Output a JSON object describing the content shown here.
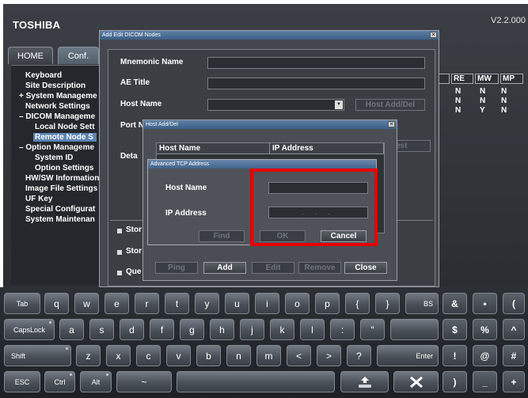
{
  "app": {
    "brand": "TOSHIBA",
    "version": "V2.2.000"
  },
  "tabs": [
    {
      "label": "HOME"
    },
    {
      "label": "Conf."
    }
  ],
  "tree": [
    "Keyboard",
    "Site Description",
    "System Manageme",
    "Network Settings",
    "DICOM Manageme",
    "Local Node Sett",
    "Remote Node S",
    "Option Manageme",
    "System ID",
    "Option Settings",
    "HW/SW Information",
    "Image File Settings",
    "UF Key",
    "Special Configurat",
    "System Maintenan"
  ],
  "right_table": {
    "headers": [
      "U",
      "RE",
      "MW",
      "MP"
    ],
    "rows": [
      [
        "N",
        "N",
        "N"
      ],
      [
        "N",
        "N",
        "N"
      ],
      [
        "N",
        "Y",
        "N"
      ]
    ]
  },
  "dicom_dialog": {
    "title": "Add Edit DICOM Nodes",
    "mnemonic_label": "Mnemonic Name",
    "ae_title_label": "AE Title",
    "host_name_label": "Host Name",
    "port_label": "Port N",
    "detail_label": "Deta",
    "host_add_del_button": "Host Add/Del",
    "test_button": "est",
    "dropdown_arrow": "▼",
    "checks": [
      "Stor",
      "Stor",
      "Que"
    ]
  },
  "host_dialog": {
    "title": "Host Add/Del",
    "col_host": "Host Name",
    "col_ip": "IP Address",
    "buttons": {
      "ping": "Ping",
      "add": "Add",
      "edit": "Edit",
      "remove": "Remove",
      "close": "Close"
    }
  },
  "tcp_dialog": {
    "title": "Advanced TCP Address",
    "host_label": "Host Name",
    "ip_label": "IP Address",
    "ip_dots": "  .   .   .  ",
    "find_button": "Find",
    "ok_button": "OK",
    "cancel_button": "Cancel"
  },
  "close_glyph": "✕",
  "keyboard": {
    "row1": [
      "Tab",
      "q",
      "w",
      "e",
      "r",
      "t",
      "y",
      "u",
      "i",
      "o",
      "p",
      "{",
      "}",
      "BS",
      "&",
      "•",
      "("
    ],
    "row2": [
      "CapsLock",
      "a",
      "s",
      "d",
      "f",
      "g",
      "h",
      "j",
      "k",
      "l",
      ":",
      "\"",
      "",
      "$",
      "%",
      "^"
    ],
    "row3": [
      "Shift",
      "z",
      "x",
      "c",
      "v",
      "b",
      "n",
      "m",
      "<",
      ">",
      "?",
      "Enter",
      "!",
      "@",
      "#"
    ],
    "row4": [
      "ESC",
      "Ctrl",
      "Alt",
      "~",
      "",
      "",
      "",
      "",
      "",
      ")",
      "_",
      "+"
    ]
  },
  "colors": {
    "highlight": "#e60000",
    "selection": "#5b84b4"
  }
}
